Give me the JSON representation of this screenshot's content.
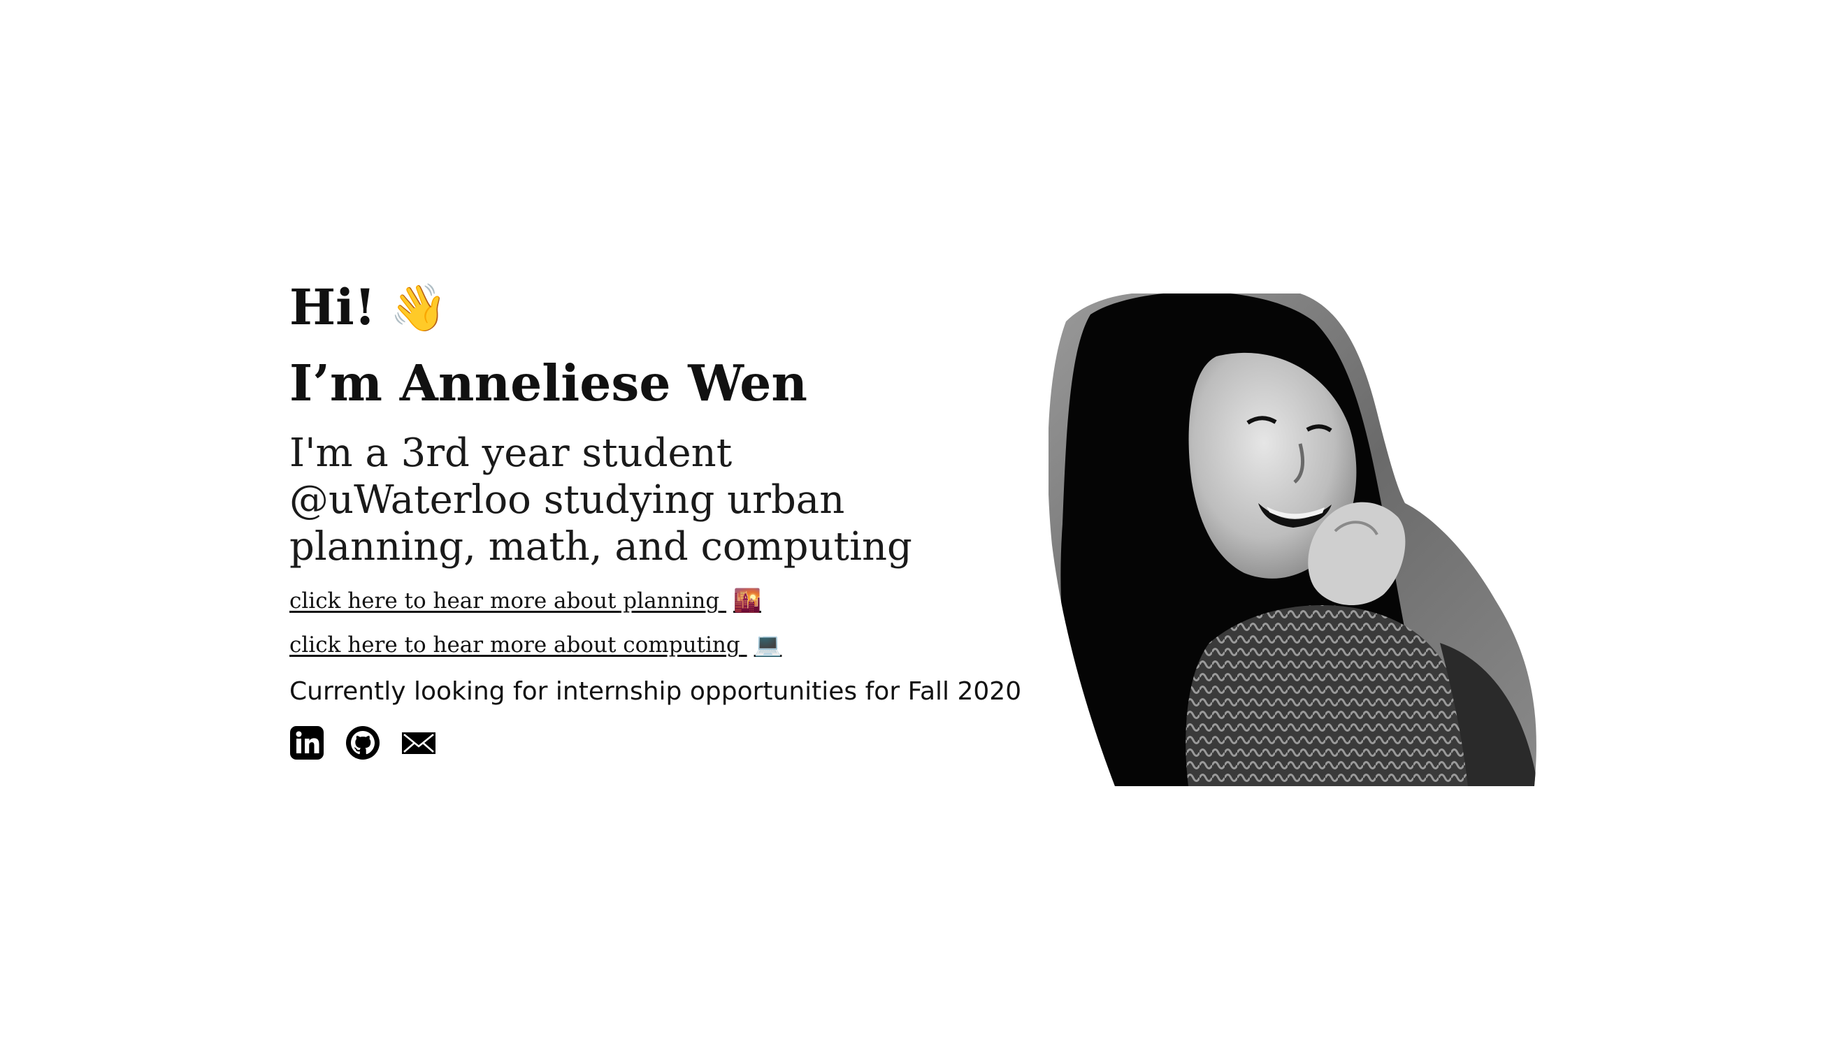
{
  "intro": {
    "greeting": "Hi!",
    "greeting_emoji": "👋",
    "name": "I’m Anneliese Wen",
    "bio": "I'm a 3rd year student @uWaterloo studying urban planning, math, and computing",
    "links": [
      {
        "label": "click here to hear more about planning",
        "emoji": "🌇"
      },
      {
        "label": "click here to hear more about computing",
        "emoji": "💻"
      }
    ],
    "status": "Currently looking for internship opportunities for Fall 2020"
  },
  "socials": [
    {
      "icon": "linkedin-icon"
    },
    {
      "icon": "github-icon"
    },
    {
      "icon": "mail-icon"
    }
  ],
  "portrait": {
    "style": "black-and-white cutout photo of a smiling person with long dark hair"
  },
  "colors": {
    "background": "#ffffff",
    "text": "#111111"
  }
}
